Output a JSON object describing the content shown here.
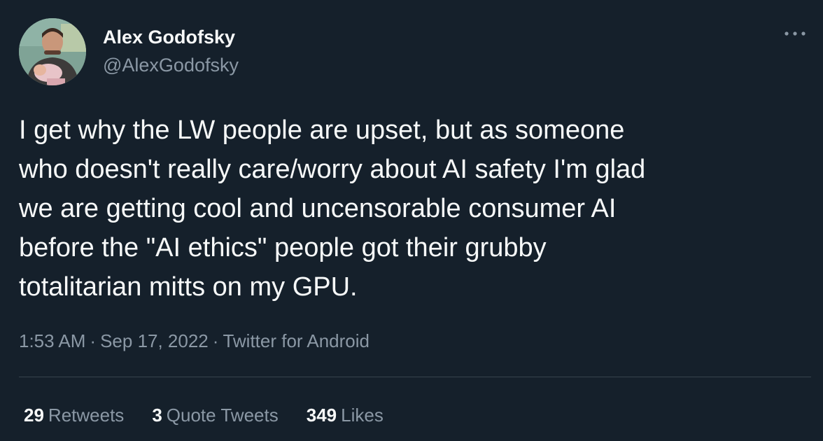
{
  "author": {
    "display_name": "Alex Godofsky",
    "handle": "@AlexGodofsky",
    "avatar_icon": "profile-photo"
  },
  "more_icon": "ellipsis-icon",
  "tweet": {
    "lines": [
      "I get why the LW people are upset, but as someone",
      "who doesn't really care/worry about AI safety I'm glad",
      "we are getting cool and uncensorable consumer AI",
      "before the \"AI ethics\" people got their grubby",
      "totalitarian mitts on my GPU."
    ]
  },
  "meta": {
    "time": "1:53 AM",
    "separator": "·",
    "date": "Sep 17, 2022",
    "source": "Twitter for Android"
  },
  "stats": {
    "retweets": {
      "count": "29",
      "label": "Retweets"
    },
    "quote_tweets": {
      "count": "3",
      "label": "Quote Tweets"
    },
    "likes": {
      "count": "349",
      "label": "Likes"
    }
  },
  "colors": {
    "background": "#15202b",
    "primary_text": "#f7f9f9",
    "secondary_text": "#8b98a5",
    "divider": "#38444d"
  }
}
